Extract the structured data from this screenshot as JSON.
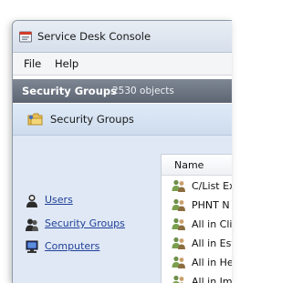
{
  "window": {
    "title": "Service Desk Console"
  },
  "menu": {
    "items": [
      "File",
      "Help"
    ]
  },
  "header": {
    "title": "Security Groups",
    "count": "2530 objects"
  },
  "content": {
    "title": "Security Groups"
  },
  "nav": {
    "links": [
      {
        "label": "Users",
        "icon": "user-icon"
      },
      {
        "label": "Security Groups",
        "icon": "group-icon"
      },
      {
        "label": "Computers",
        "icon": "computer-icon"
      }
    ]
  },
  "list": {
    "column": "Name",
    "rows": [
      "C/List Ex",
      "PHNT N",
      "All in Cli",
      "All in Esta",
      "All in He",
      "All in Ima"
    ]
  }
}
